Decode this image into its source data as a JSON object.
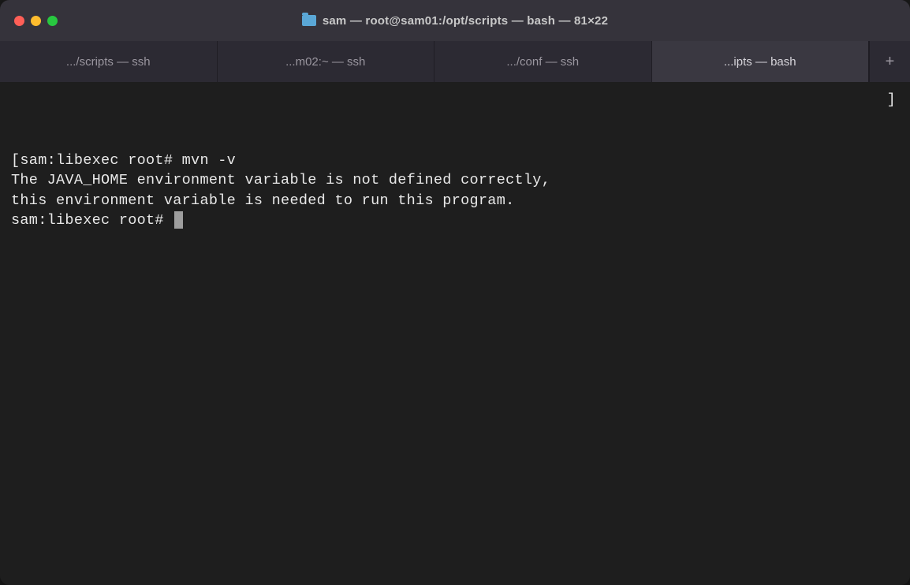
{
  "window": {
    "title": "sam — root@sam01:/opt/scripts — bash — 81×22"
  },
  "tabs": [
    {
      "label": ".../scripts — ssh",
      "active": false
    },
    {
      "label": "...m02:~ — ssh",
      "active": false
    },
    {
      "label": ".../conf — ssh",
      "active": false
    },
    {
      "label": "...ipts — bash",
      "active": true
    }
  ],
  "terminal": {
    "lines": [
      "[sam:libexec root# mvn -v",
      "The JAVA_HOME environment variable is not defined correctly,",
      "this environment variable is needed to run this program.",
      "sam:libexec root# "
    ],
    "right_bracket": "]"
  }
}
